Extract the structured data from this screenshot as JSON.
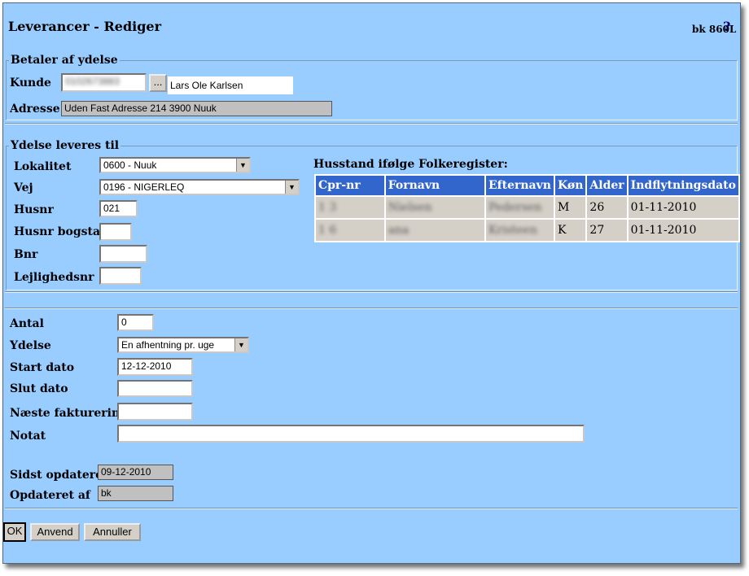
{
  "header": {
    "title": "Leverancer - Rediger",
    "code": "bk 860L",
    "help": "?"
  },
  "payer": {
    "legend": "Betaler af ydelse",
    "customer_label": "Kunde",
    "customer_id": "0102673883",
    "lookup_label": "...",
    "customer_name": "Lars Ole Karlsen",
    "address_label": "Adresse",
    "address": "Uden Fast Adresse 214 3900  Nuuk"
  },
  "delivery": {
    "legend": "Ydelse leveres til",
    "locality_label": "Lokalitet",
    "locality_value": "0600 - Nuuk",
    "road_label": "Vej",
    "road_value": "0196 - NIGERLEQ",
    "houseno_label": "Husnr",
    "houseno_value": "021",
    "houseletter_label": "Husnr bogstav",
    "bnr_label": "Bnr",
    "apartment_label": "Lejlighedsnr"
  },
  "household": {
    "title": "Husstand ifølge Folkeregister:",
    "columns": [
      "Cpr-nr",
      "Fornavn",
      "Efternavn",
      "Køn",
      "Alder",
      "Indflytningsdato"
    ],
    "rows": [
      [
        "1      3",
        "       Nielsen",
        "Pedersen",
        "M",
        "26",
        "01-11-2010"
      ],
      [
        "1      6",
        "          ana",
        "Kristeen",
        "K",
        "27",
        "01-11-2010"
      ]
    ]
  },
  "service": {
    "quantity_label": "Antal",
    "quantity_value": "0",
    "service_label": "Ydelse",
    "service_value": "En afhentning pr. uge",
    "start_label": "Start dato",
    "start_value": "12-12-2010",
    "end_label": "Slut dato",
    "nextbill_label": "Næste fakturering",
    "note_label": "Notat"
  },
  "meta": {
    "updated_label": "Sidst opdateret",
    "updated_value": "09-12-2010",
    "updatedby_label": "Opdateret af",
    "updatedby_value": "bk"
  },
  "buttons": {
    "ok": "OK",
    "apply": "Anvend",
    "cancel": "Annuller"
  }
}
